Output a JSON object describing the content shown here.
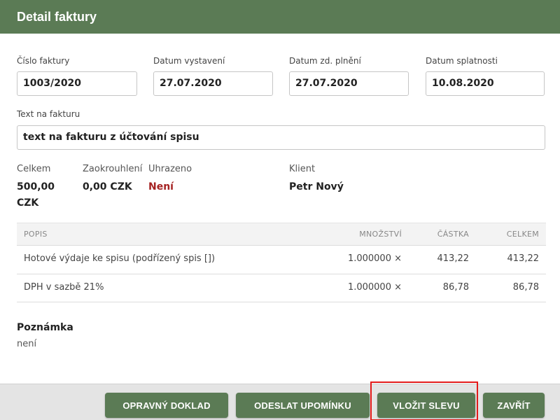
{
  "header": {
    "title": "Detail faktury"
  },
  "fields": {
    "invoice_number": {
      "label": "Číslo faktury",
      "value": "1003/2020"
    },
    "issue_date": {
      "label": "Datum vystavení",
      "value": "27.07.2020"
    },
    "tax_date": {
      "label": "Datum zd. plnění",
      "value": "27.07.2020"
    },
    "due_date": {
      "label": "Datum splatnosti",
      "value": "10.08.2020"
    },
    "invoice_text": {
      "label": "Text na fakturu",
      "value": "text na fakturu z účtování spisu"
    }
  },
  "summary": {
    "total": {
      "label": "Celkem",
      "value_line1": "500,00",
      "value_line2": "CZK"
    },
    "rounding": {
      "label": "Zaokrouhlení",
      "value": "0,00 CZK"
    },
    "paid": {
      "label": "Uhrazeno",
      "value": "Není"
    },
    "client": {
      "label": "Klient",
      "value": "Petr Nový"
    }
  },
  "table": {
    "headers": {
      "description": "POPIS",
      "quantity": "MNOŽSTVÍ",
      "amount": "ČÁSTKA",
      "total": "CELKEM"
    },
    "rows": [
      {
        "description": "Hotové výdaje ke spisu (podřízený spis [])",
        "quantity": "1.000000 ×",
        "amount": "413,22",
        "total": "413,22"
      },
      {
        "description": "DPH v sazbě 21%",
        "quantity": "1.000000 ×",
        "amount": "86,78",
        "total": "86,78"
      }
    ]
  },
  "note": {
    "label": "Poznámka",
    "value": "není"
  },
  "buttons": {
    "correction": "OPRAVNÝ DOKLAD",
    "reminder": "ODESLAT UPOMÍNKU",
    "discount": "VLOŽIT SLEVU",
    "close": "ZAVŘÍT"
  },
  "colors": {
    "header_bg": "#5b7b55",
    "button_bg": "#5b7b55",
    "status_red": "#a52222",
    "highlight": "#e31b1b"
  }
}
